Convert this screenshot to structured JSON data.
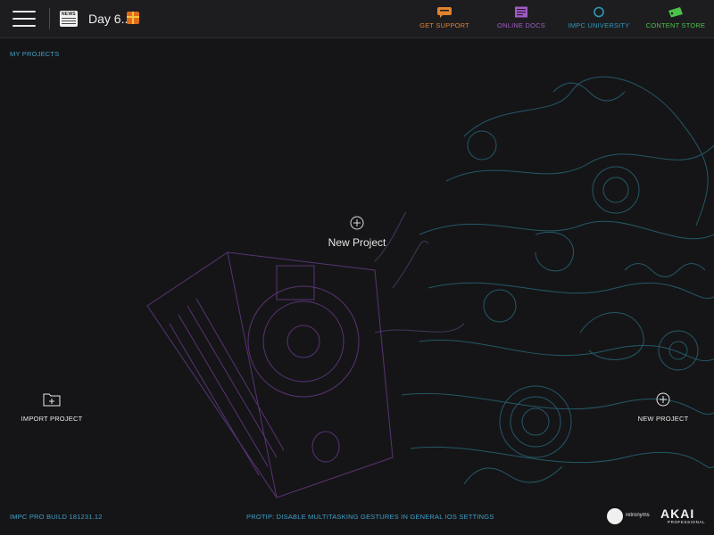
{
  "header": {
    "news_badge": "NEWS",
    "day_label": "Day 6...",
    "links": [
      {
        "label": "GET SUPPORT",
        "icon": "chat-bubble-icon",
        "color": "#e0832f"
      },
      {
        "label": "ONLINE DOCS",
        "icon": "document-icon",
        "color": "#a05cc4"
      },
      {
        "label": "IMPC UNIVERSITY",
        "icon": "ring-icon",
        "color": "#2f98b8"
      },
      {
        "label": "CONTENT STORE",
        "icon": "ticket-icon",
        "color": "#4cc24a"
      }
    ]
  },
  "breadcrumb": "MY PROJECTS",
  "main": {
    "center_new_label": "New Project",
    "import_label": "IMPORT PROJECT",
    "new_label": "NEW PROJECT"
  },
  "footer": {
    "build": "IMPC PRO BUILD 181231.12",
    "protip": "PROTIP: DISABLE MULTITASKING GESTURES IN GENERAL IOS SETTINGS",
    "retronyms": "retronyms",
    "akai": "AKAI",
    "akai_sub": "PROFESSIONAL"
  }
}
